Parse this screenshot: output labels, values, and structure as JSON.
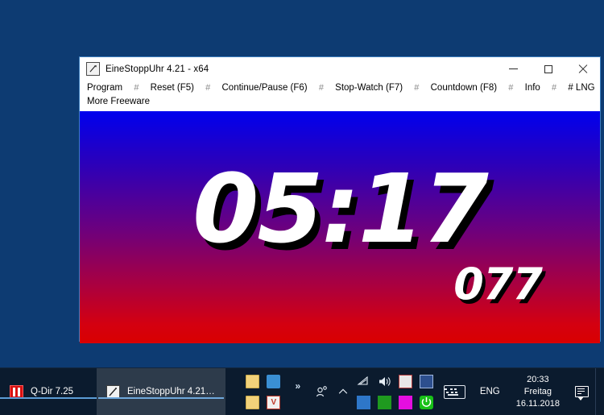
{
  "desktop": {
    "background_color": "#0d3b72"
  },
  "window": {
    "title": "EineStoppUhr 4.21 - x64",
    "icon": "stopwatch-icon",
    "controls": {
      "minimize": "minimize",
      "maximize": "maximize",
      "close": "close"
    },
    "menu": {
      "separator": "#",
      "row1": [
        "Program",
        "Reset  (F5)",
        "Continue/Pause (F6)",
        "Stop-Watch  (F7)",
        "Countdown  (F8)",
        "Info",
        "# LNG"
      ],
      "row2": [
        "More Freeware"
      ]
    },
    "display": {
      "time": "05:17",
      "milliseconds": "077",
      "gradient_top": "#0000ee",
      "gradient_bottom": "#d90000",
      "text_color": "#ffffff",
      "shadow_color": "#000000"
    }
  },
  "taskbar": {
    "background_color": "#0b1b2e",
    "buttons": [
      {
        "label": "Q-Dir 7.25",
        "icon": "qdir-icon",
        "active": false
      },
      {
        "label": "EineStoppUhr 4.21 - x...",
        "icon": "stopwatch-icon",
        "active": true
      }
    ],
    "tray": {
      "overflow_label": "»",
      "icons_left": [
        {
          "name": "folder-icon"
        },
        {
          "name": "network-drive-icon"
        },
        {
          "name": "folder-icon-2"
        },
        {
          "name": "vlc-icon",
          "label": "V"
        }
      ],
      "people_icon": "people-icon",
      "chevron_icon": "chevron-up-icon",
      "icons_right": [
        {
          "name": "wifi-icon"
        },
        {
          "name": "volume-icon"
        },
        {
          "name": "calendar-icon"
        },
        {
          "name": "calculator-icon"
        },
        {
          "name": "card-reader-icon"
        },
        {
          "name": "grid-green-icon"
        },
        {
          "name": "magenta-square-icon"
        },
        {
          "name": "power-icon"
        }
      ],
      "keyboard_icon": "keyboard-icon",
      "language": "ENG",
      "clock": {
        "time": "20:33",
        "weekday": "Freitag",
        "date": "16.11.2018"
      },
      "action_center_icon": "action-center-icon"
    }
  }
}
